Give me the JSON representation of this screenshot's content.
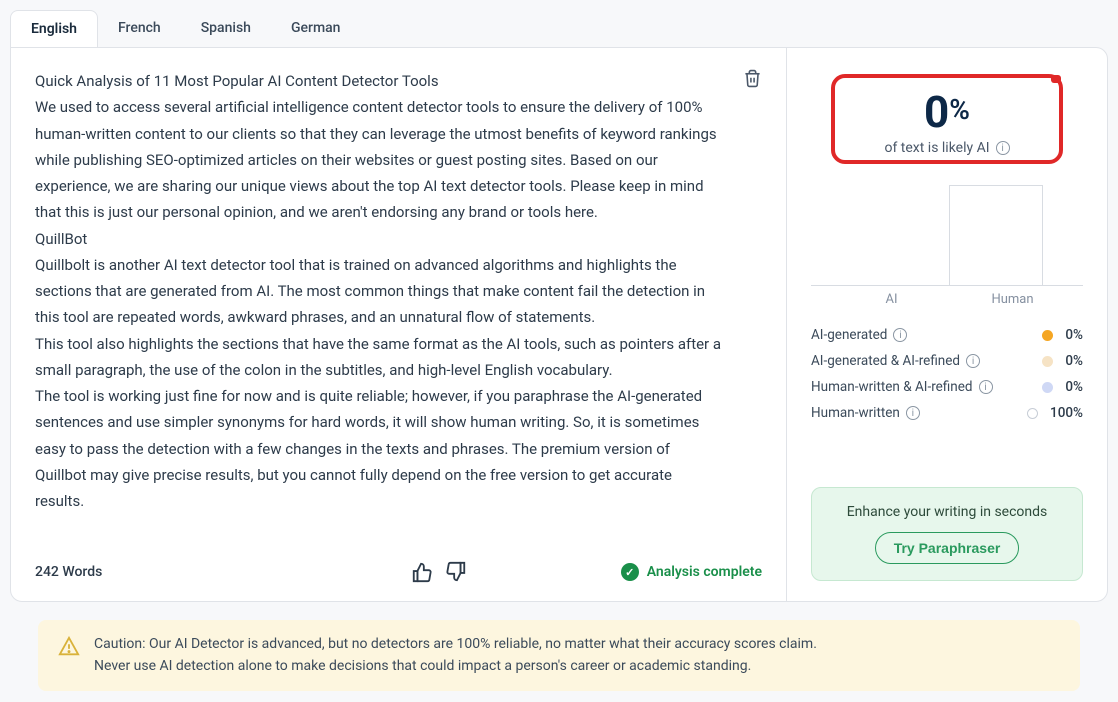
{
  "tabs": [
    "English",
    "French",
    "Spanish",
    "German"
  ],
  "active_tab": 0,
  "content": {
    "title": "Quick Analysis of 11 Most Popular AI Content Detector Tools",
    "p1": "We used to access several artificial intelligence content detector tools to ensure the delivery of 100% human-written content to our clients so that they can leverage the utmost benefits of keyword rankings while publishing SEO-optimized articles on their websites or guest posting sites. Based on our experience, we are sharing our unique views about the top AI text detector tools. Please keep in mind that this is just our personal opinion, and we aren't endorsing any brand or tools here.",
    "h2": "QuillBot",
    "p2": "Quillbolt is another AI text detector tool that is trained on advanced algorithms and highlights the sections that are generated from AI. The most common things that make content fail the detection in this tool are repeated words, awkward phrases, and an unnatural flow of statements.",
    "p3": "This tool also highlights the sections that have the same format as the AI tools, such as pointers after a small paragraph, the use of the colon in the subtitles, and high-level English vocabulary.",
    "p4": "The tool is working just fine for now and is quite reliable; however, if you paraphrase the AI-generated sentences and use simpler synonyms for hard words, it will show human writing. So, it is sometimes easy to pass the detection with a few changes in the texts and phrases. The premium version of Quillbot may give precise results, but you cannot fully depend on the free version to get accurate results."
  },
  "footer": {
    "word_count": "242 Words",
    "status": "Analysis complete"
  },
  "score": {
    "value": "0",
    "suffix": "%",
    "label": "of text is likely AI"
  },
  "chart_data": {
    "type": "bar",
    "categories": [
      "AI",
      "Human"
    ],
    "values": [
      0,
      100
    ],
    "xlabel": "",
    "ylabel": "",
    "ylim": [
      0,
      100
    ]
  },
  "chart_labels": {
    "ai": "AI",
    "human": "Human"
  },
  "legend": [
    {
      "label": "AI-generated",
      "value": "0%",
      "color": "#f5a623"
    },
    {
      "label": "AI-generated & AI-refined",
      "value": "0%",
      "color": "#f6e3c5"
    },
    {
      "label": "Human-written & AI-refined",
      "value": "0%",
      "color": "#cfd8f5"
    },
    {
      "label": "Human-written",
      "value": "100%",
      "color": "#ffffff",
      "border": "#c7cdd6"
    }
  ],
  "cta": {
    "text": "Enhance your writing in seconds",
    "button": "Try Paraphraser"
  },
  "caution": {
    "line1": "Caution: Our AI Detector is advanced, but no detectors are 100% reliable, no matter what their accuracy scores claim.",
    "line2": "Never use AI detection alone to make decisions that could impact a person's career or academic standing."
  }
}
